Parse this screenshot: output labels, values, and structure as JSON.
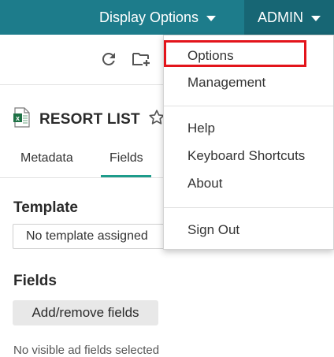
{
  "header": {
    "display_options_label": "Display Options",
    "admin_label": "ADMIN",
    "background_color": "#1d7c8b",
    "admin_background_color": "#176674"
  },
  "toolbar": {
    "icons": [
      "refresh-icon",
      "add-folder-icon"
    ]
  },
  "document": {
    "title": "RESORT LIST",
    "file_icon": "excel-file-icon",
    "favorite_icon": "star-outline-icon"
  },
  "tabs": [
    {
      "label": "Metadata",
      "active": false
    },
    {
      "label": "Fields",
      "active": true
    }
  ],
  "template_section": {
    "heading": "Template",
    "selected_value": "No template assigned"
  },
  "fields_section": {
    "heading": "Fields",
    "button_label": "Add/remove fields",
    "cut_off_text": "No visible ad fields selected"
  },
  "admin_menu": {
    "items": [
      {
        "label": "Options",
        "highlighted": true
      },
      {
        "label": "Management"
      },
      {
        "label": "Help"
      },
      {
        "label": "Keyboard Shortcuts"
      },
      {
        "label": "About"
      },
      {
        "label": "Sign Out"
      }
    ],
    "highlight_color": "#e3141b"
  }
}
